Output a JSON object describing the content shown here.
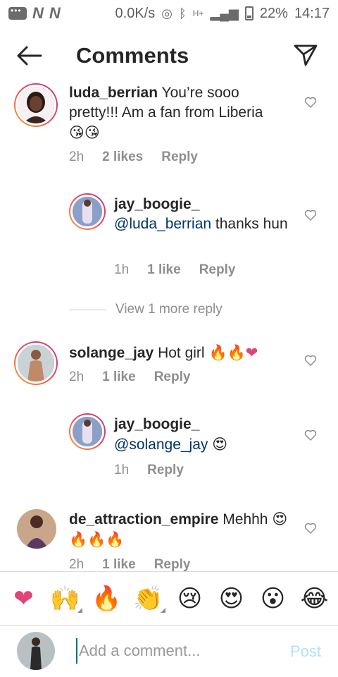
{
  "status_bar": {
    "carrier_1": "N",
    "carrier_2": "N",
    "speed": "0.0K/s",
    "network": "H+",
    "battery": "22%",
    "time": "14:17"
  },
  "header": {
    "title": "Comments"
  },
  "comments": [
    {
      "username": "luda_berrian",
      "text": "You’re sooo pretty!!! Am a fan from Liberia",
      "emoji": "😘😘",
      "time": "2h",
      "likes": "2 likes",
      "reply": "Reply"
    },
    {
      "username": "jay_boogie_",
      "mention": "@luda_berrian",
      "text": "thanks hun",
      "time": "1h",
      "likes": "1 like",
      "reply": "Reply"
    },
    {
      "username": "solange_jay",
      "text": "Hot girl",
      "emoji": "🔥🔥❤",
      "time": "2h",
      "likes": "1 like",
      "reply": "Reply"
    },
    {
      "username": "jay_boogie_",
      "mention": "@solange_jay",
      "emoji": "😍",
      "time": "1h",
      "reply": "Reply"
    },
    {
      "username": "de_attraction_empire",
      "text": "Mehhh",
      "emoji": "😍🔥🔥🔥",
      "time": "2h",
      "likes": "1 like",
      "reply": "Reply"
    }
  ],
  "view_more": "View 1 more reply",
  "emoji_bar": [
    "❤",
    "🙌",
    "🔥",
    "👏",
    "😢",
    "😍",
    "😮",
    "😂"
  ],
  "composer": {
    "placeholder": "Add a comment...",
    "post_label": "Post"
  },
  "colors": {
    "mention": "#003569",
    "meta": "#8e8e8e",
    "post_disabled": "#b2dffc"
  }
}
